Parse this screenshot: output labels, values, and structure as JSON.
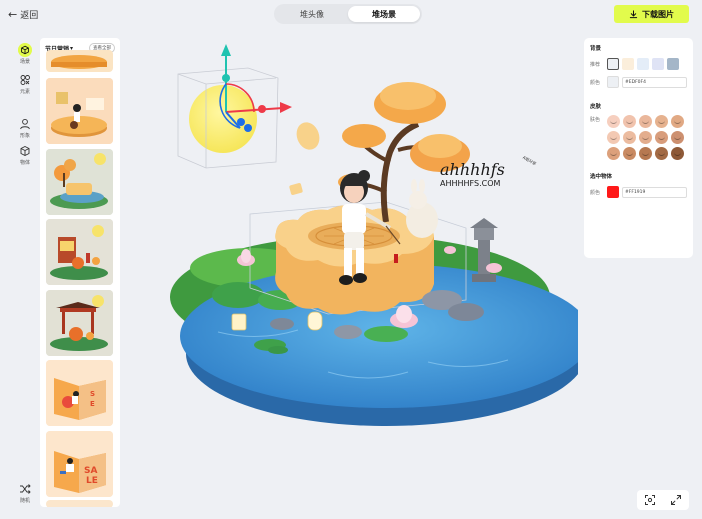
{
  "topbar": {
    "back_label": "返回",
    "tabs": [
      {
        "label": "堆头像",
        "active": false
      },
      {
        "label": "堆场景",
        "active": true
      }
    ],
    "download_label": "下载图片",
    "accent": "#e2fb4c"
  },
  "rail": {
    "items": [
      {
        "label": "场景",
        "icon": "scene-icon",
        "active": true
      },
      {
        "label": "元素",
        "icon": "elements-icon",
        "active": false
      },
      {
        "label": "形象",
        "icon": "avatar-icon",
        "active": false
      },
      {
        "label": "物体",
        "icon": "object-icon",
        "active": false
      },
      {
        "label": "随机",
        "icon": "shuffle-icon",
        "active": false
      }
    ]
  },
  "left_panel": {
    "title": "节日营销",
    "view_all": "查看全部",
    "thumbnails": [
      {
        "theme": "orange podium partial"
      },
      {
        "theme": "campfire cooking scene"
      },
      {
        "theme": "mooncake with tree"
      },
      {
        "theme": "stall lantern scene"
      },
      {
        "theme": "pavilion pumpkin scene"
      },
      {
        "theme": "SALE fruit scene"
      },
      {
        "theme": "SALE jumping scene"
      }
    ]
  },
  "canvas": {
    "watermark_title": "ahhhhfs",
    "watermark_sub": "AHHHHFS.COM",
    "watermark_badge": "A姐分享"
  },
  "right_panel": {
    "background": {
      "title": "背景",
      "recommend_label": "推荐",
      "recommended_colors": [
        "#edf0f4",
        "#fbeedb",
        "#e4edf8",
        "#dfe3f5",
        "#a4b6c8"
      ],
      "color_label": "颜色",
      "color_value": "#EDF0F4",
      "color_swatch": "#edf0f4"
    },
    "skin": {
      "title": "皮肤",
      "color_label": "肤色",
      "tones": [
        "#f6cfbf",
        "#f1c3ad",
        "#eab79b",
        "#e6b28f",
        "#e1a984",
        "#f3c9b3",
        "#ecbca0",
        "#e3ad8d",
        "#d89d7c",
        "#cd9070",
        "#dca07b",
        "#c98a62",
        "#b67850",
        "#a36a44",
        "#8e5937"
      ]
    },
    "selected": {
      "title": "选中物体",
      "color_label": "颜色",
      "color_value": "#FF1919",
      "color_swatch": "#ff1919"
    }
  },
  "tools": {
    "items": [
      {
        "icon": "focus-icon"
      },
      {
        "icon": "fullscreen-icon"
      }
    ]
  }
}
